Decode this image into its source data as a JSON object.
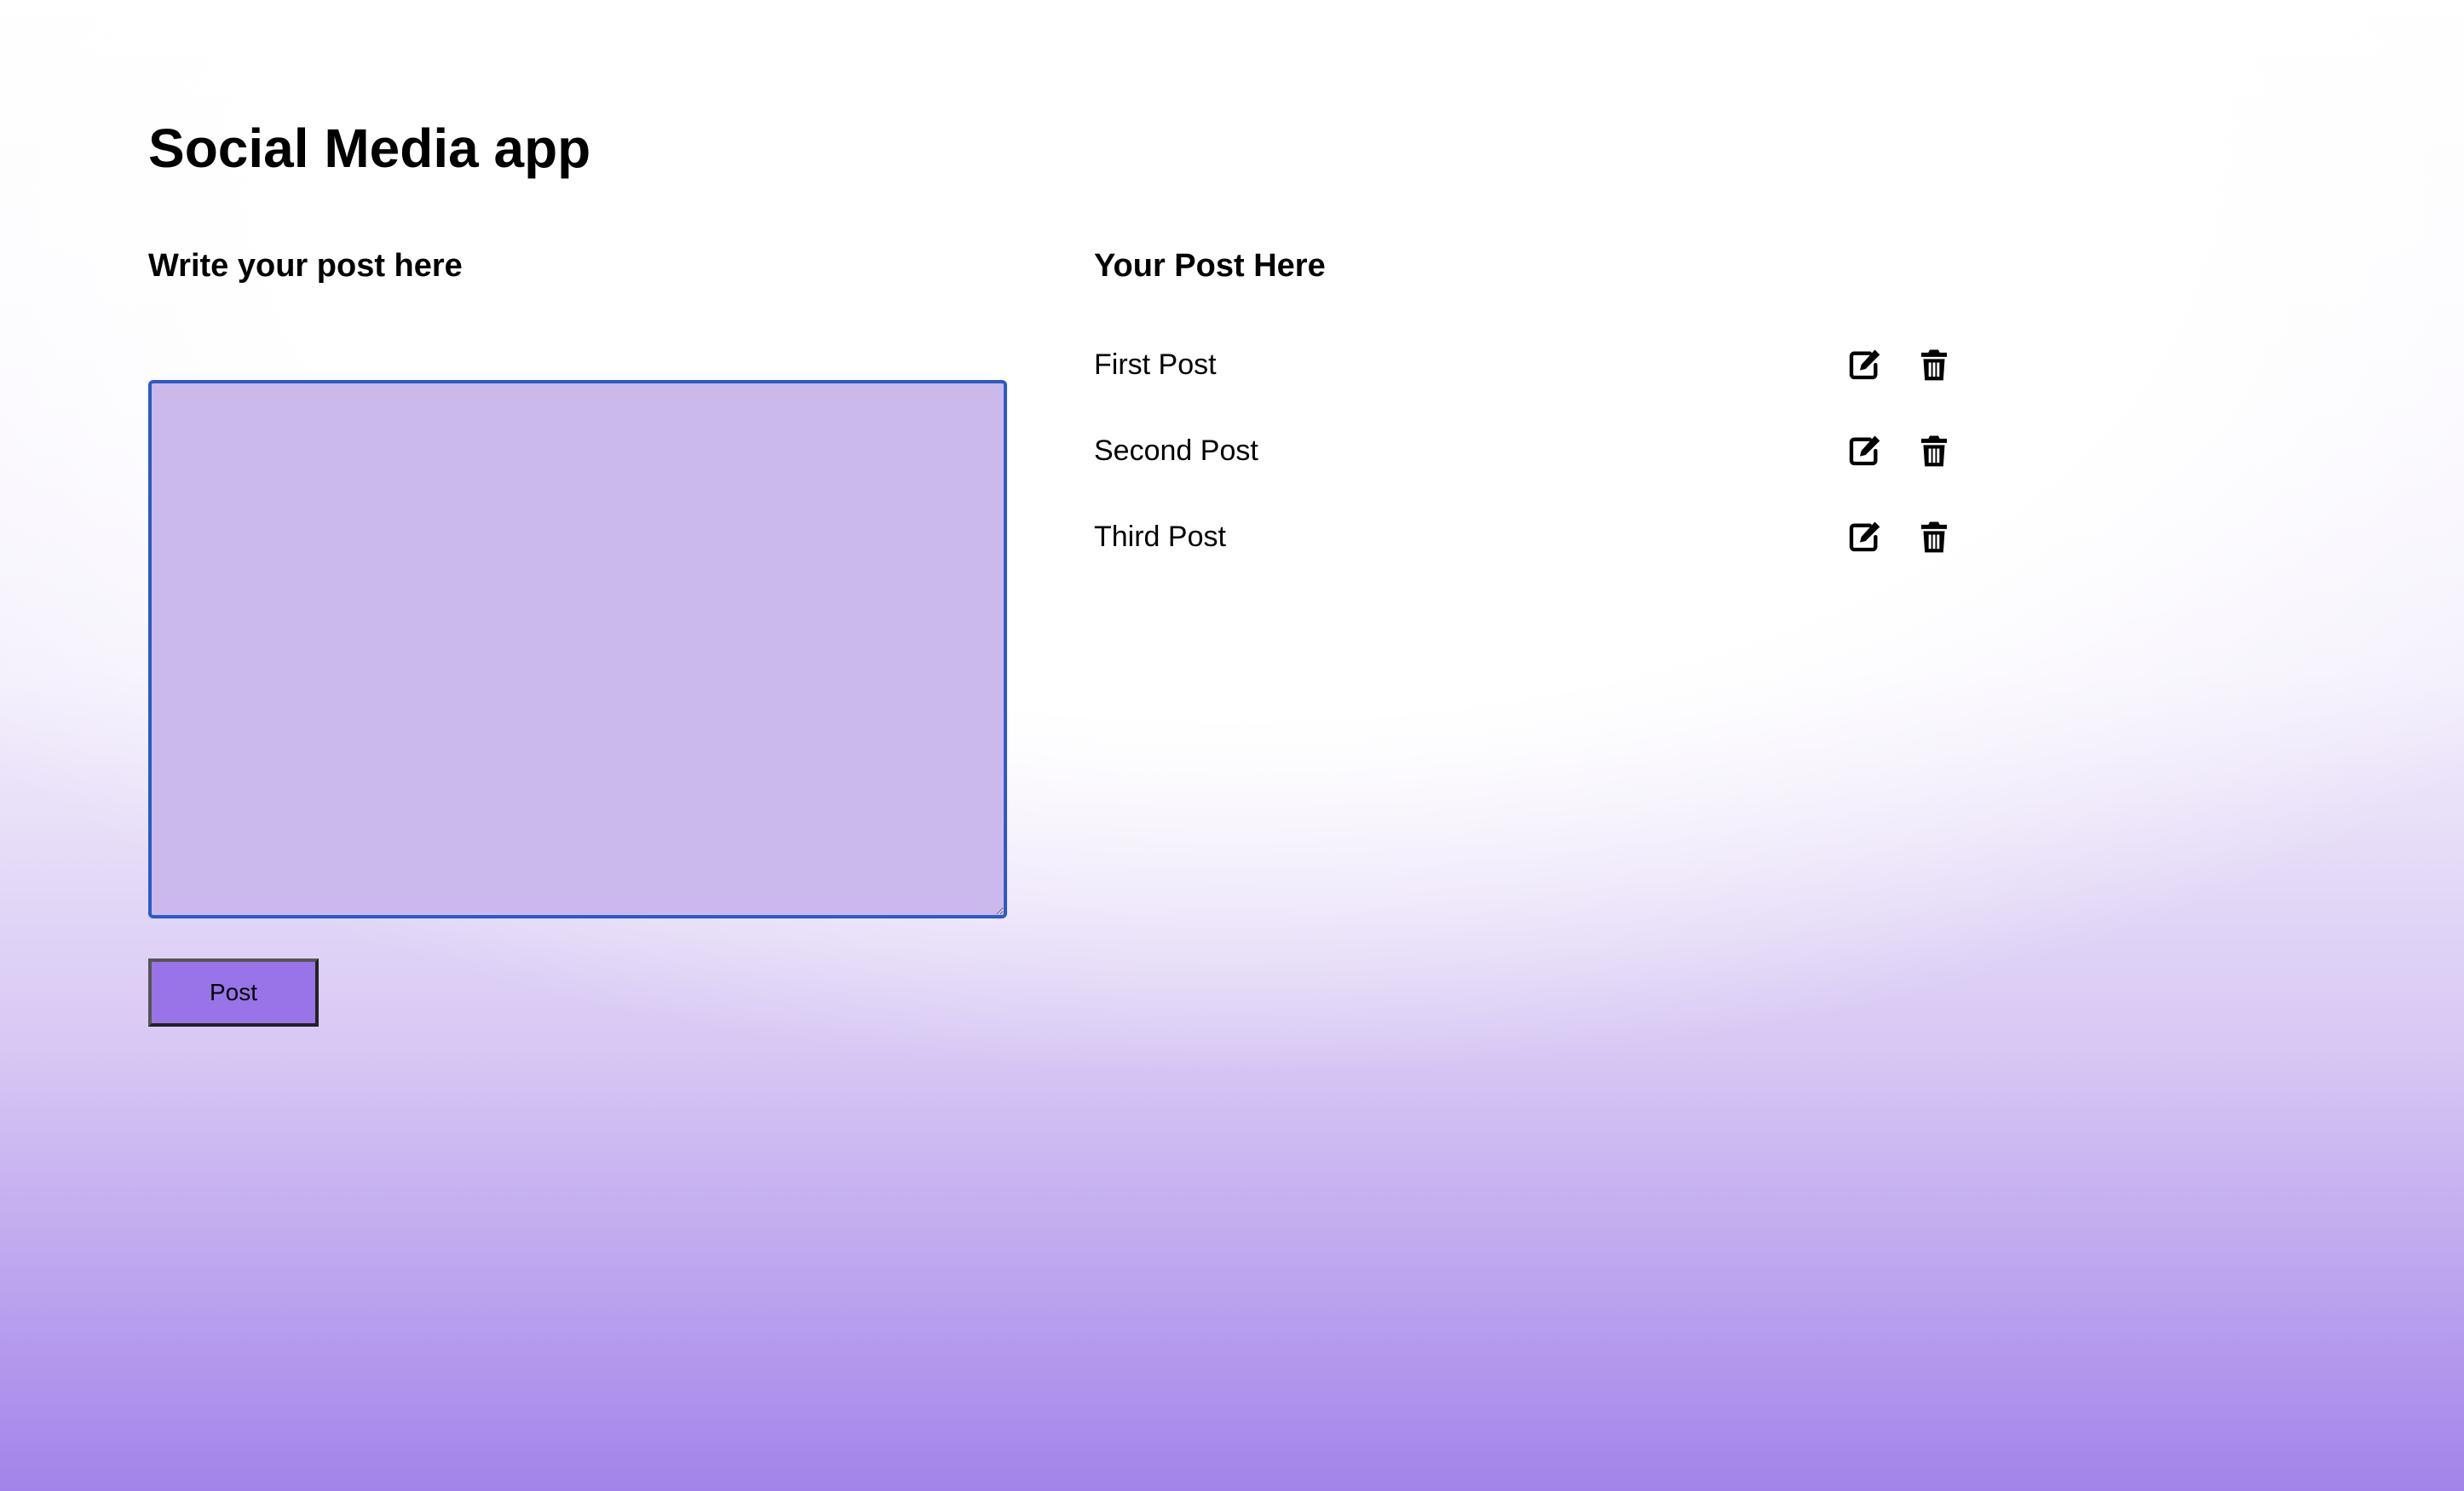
{
  "app": {
    "title": "Social Media app"
  },
  "compose": {
    "heading": "Write your post here",
    "textarea_value": "",
    "post_button_label": "Post"
  },
  "posts": {
    "heading": "Your Post Here",
    "items": [
      {
        "text": "First Post",
        "actions": [
          "edit-icon",
          "trash-icon"
        ]
      },
      {
        "text": "Second Post",
        "actions": [
          "edit-icon",
          "trash-icon"
        ]
      },
      {
        "text": "Third Post",
        "actions": [
          "edit-icon",
          "trash-icon"
        ]
      }
    ]
  },
  "colors": {
    "textarea_background": "#cbb9ec",
    "textarea_border": "#2a5bc8",
    "button_background": "#9874e8",
    "gradient_bottom": "#a283ea"
  }
}
